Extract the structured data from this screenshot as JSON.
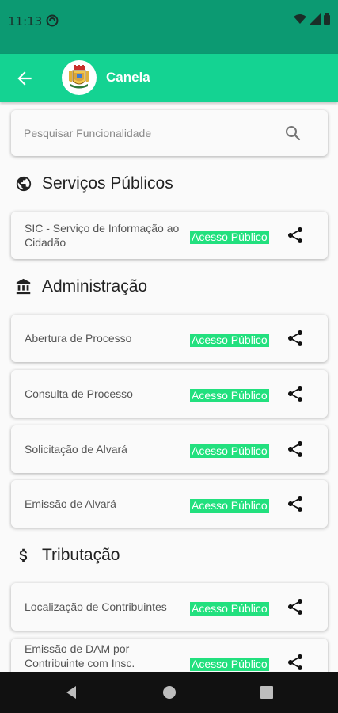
{
  "status_bar": {
    "time": "11:13"
  },
  "app_bar": {
    "title": "Canela"
  },
  "search": {
    "placeholder": "Pesquisar Funcionalidade"
  },
  "sections": [
    {
      "title": "Serviços Públicos",
      "icon": "globe-icon",
      "items": [
        {
          "label": "SIC - Serviço de Informação ao Cidadão",
          "badge": "Acesso Público"
        }
      ]
    },
    {
      "title": "Administração",
      "icon": "bank-icon",
      "items": [
        {
          "label": "Abertura de Processo",
          "badge": "Acesso Público"
        },
        {
          "label": "Consulta de Processo",
          "badge": "Acesso Público"
        },
        {
          "label": "Solicitação de Alvará",
          "badge": "Acesso Público"
        },
        {
          "label": "Emissão de Alvará",
          "badge": "Acesso Público"
        }
      ]
    },
    {
      "title": "Tributação",
      "icon": "dollar-icon",
      "items": [
        {
          "label": "Localização de Contribuintes",
          "badge": "Acesso Público"
        },
        {
          "label": "Emissão de DAM por Contribuinte com Insc. Municipal",
          "badge": "Acesso Público"
        }
      ]
    }
  ],
  "colors": {
    "header": "#14d392",
    "status_bar": "#0c9a72",
    "badge": "#22e07e"
  }
}
